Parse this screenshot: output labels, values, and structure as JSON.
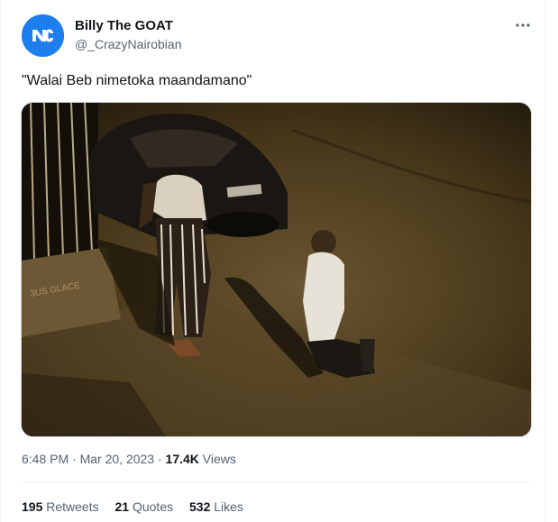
{
  "author": {
    "display_name": "Billy The GOAT",
    "handle": "@_CrazyNairobian",
    "avatar_icon": "nc-logo-avatar",
    "avatar_color": "#1d7ef0"
  },
  "more_icon": "more-dots-icon",
  "tweet": {
    "text": "\"Walai Beb nimetoka maandamano\"",
    "media_description_icon": "photo"
  },
  "meta": {
    "time": "6:48 PM",
    "separator": "·",
    "date": "Mar 20, 2023",
    "views_count": "17.4K",
    "views_label": "Views"
  },
  "stats": {
    "retweets_count": "195",
    "retweets_label": "Retweets",
    "quotes_count": "21",
    "quotes_label": "Quotes",
    "likes_count": "532",
    "likes_label": "Likes"
  },
  "colors": {
    "text_primary": "#0f1419",
    "text_secondary": "#536471",
    "border": "#eff3f4"
  }
}
